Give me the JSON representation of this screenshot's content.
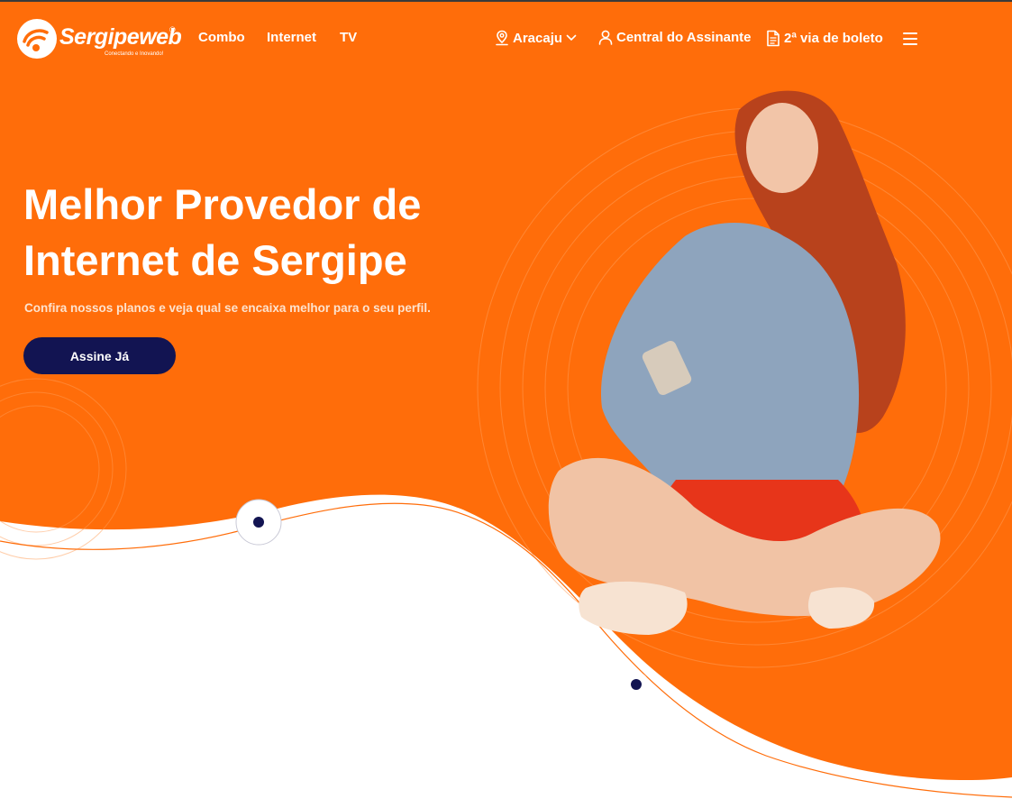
{
  "brand": {
    "name": "Sergipeweb",
    "registered": "®",
    "tagline": "Conectando e Inovando!"
  },
  "nav": {
    "left_links": [
      {
        "label": "Combo"
      },
      {
        "label": "Internet"
      },
      {
        "label": "TV"
      }
    ],
    "city": {
      "label": "Aracaju",
      "icon": "location-pin-icon"
    },
    "subscriber_center": {
      "label": "Central do Assinante",
      "icon": "user-icon"
    },
    "invoice": {
      "label": "2ª via de boleto",
      "icon": "document-icon"
    },
    "menu_icon": "hamburger-menu-icon"
  },
  "hero": {
    "title_line1": "Melhor Provedor de",
    "title_line2": "Internet de Sergipe",
    "subtitle": "Confira nossos planos e veja qual se encaixa melhor para o seu perfil.",
    "cta_label": "Assine Já",
    "image": "smiling-woman-with-phone-and-earphones"
  },
  "colors": {
    "primary": "#FF6D0A",
    "accent": "#121452",
    "text_on_primary": "#FFFFFF"
  }
}
